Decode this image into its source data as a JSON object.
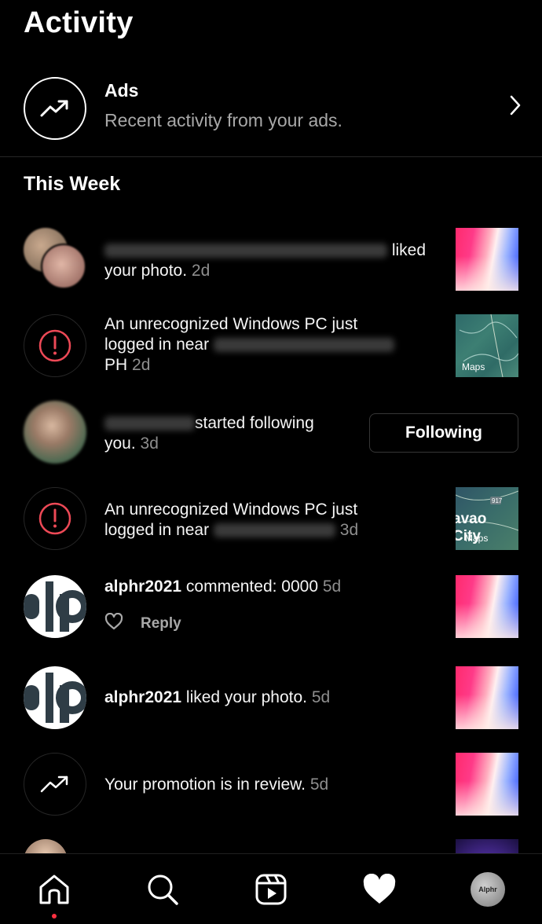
{
  "header": {
    "title": "Activity"
  },
  "ads": {
    "title": "Ads",
    "subtitle": "Recent activity from your ads."
  },
  "section": {
    "title": "This Week"
  },
  "items": [
    {
      "action": "liked",
      "line2": "your photo.",
      "time": "2d"
    },
    {
      "line1": "An unrecognized Windows PC just",
      "line2": "logged in near",
      "line3": "PH",
      "time": "2d",
      "map_label": "Maps"
    },
    {
      "action": "started following",
      "line2": "you.",
      "time": "3d",
      "button": "Following"
    },
    {
      "line1": "An unrecognized Windows PC just",
      "line2": "logged in near",
      "time": "3d",
      "map_city": "avao City",
      "map_label": "Maps",
      "map_badge": "917"
    },
    {
      "user": "alphr2021",
      "action": "commented: 0000",
      "time": "5d",
      "reply": "Reply"
    },
    {
      "user": "alphr2021",
      "action": "liked your photo.",
      "time": "5d"
    },
    {
      "action": "Your promotion is in review.",
      "time": "5d"
    }
  ],
  "nav": {
    "profile_label": "Alphr"
  },
  "icons": {
    "ads": "trending-up-icon",
    "chevron": "chevron-right-icon",
    "alert": "alert-circle-icon",
    "heart": "heart-icon",
    "home": "home-icon",
    "search": "search-icon",
    "reels": "reels-icon",
    "activity": "heart-filled-icon",
    "profile": "profile-avatar"
  },
  "colors": {
    "alert": "#ed4956",
    "muted": "#8e8e8e",
    "accent_dot": "#ff3040"
  }
}
